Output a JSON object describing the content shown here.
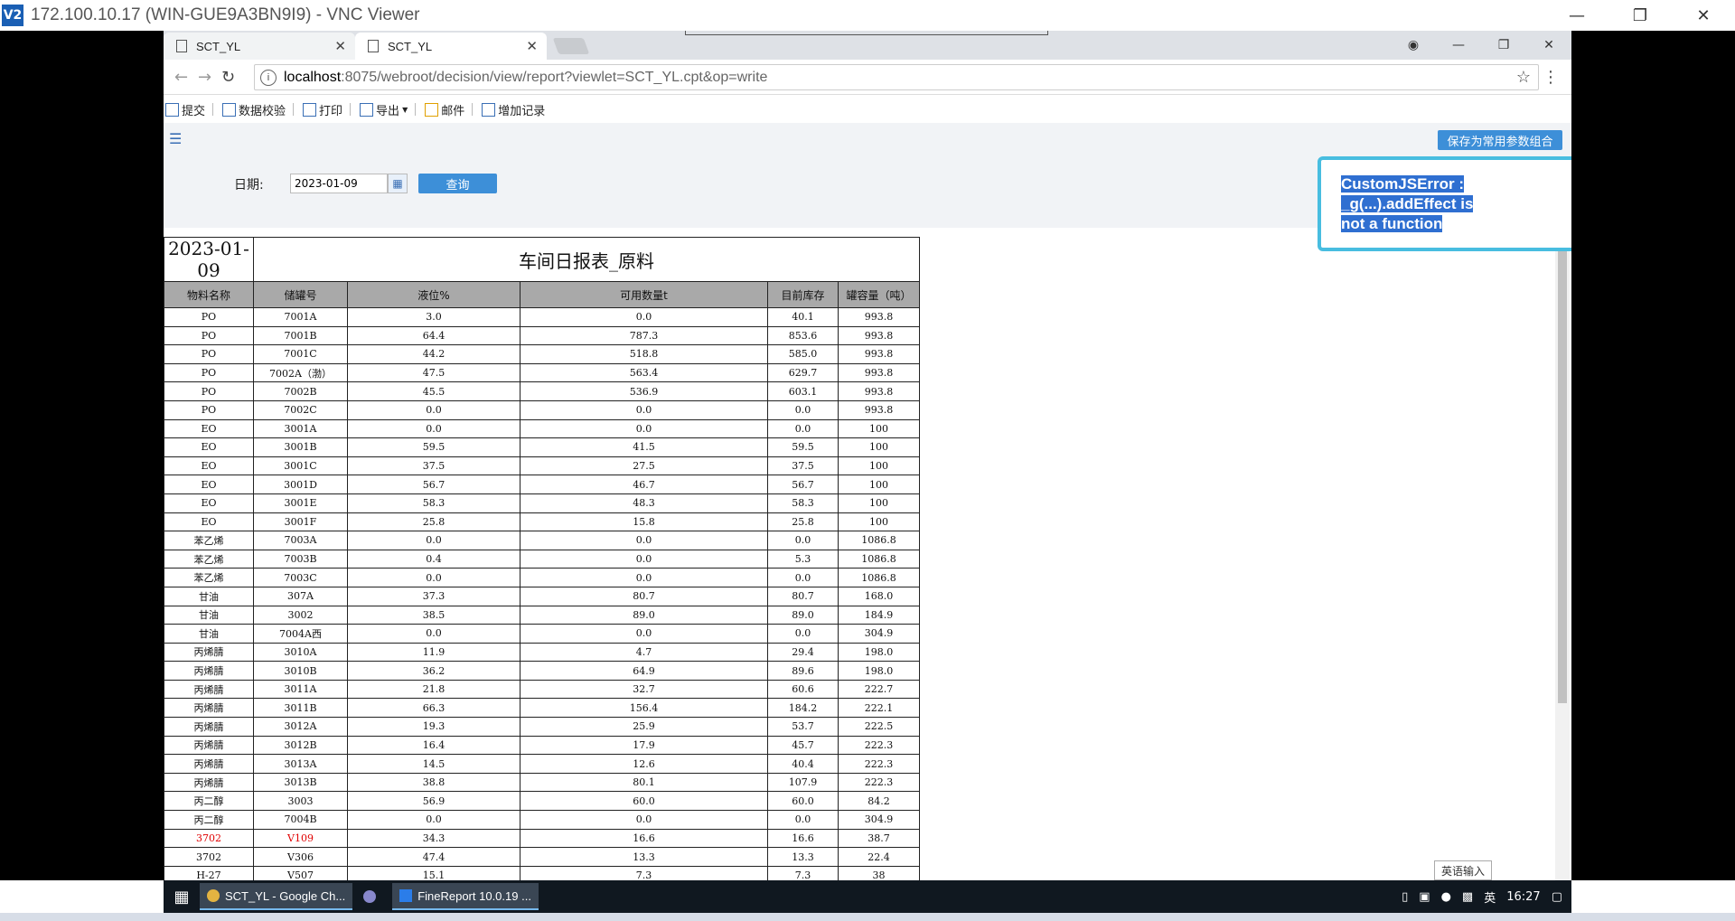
{
  "vnc": {
    "title": "172.100.10.17 (WIN-GUE9A3BN9I9) - VNC Viewer",
    "logo": "V2"
  },
  "browser": {
    "tabs": [
      {
        "label": "SCT_YL"
      },
      {
        "label": "SCT_YL"
      }
    ],
    "url_host": "localhost",
    "url_path": ":8075/webroot/decision/view/report?viewlet=SCT_YL.cpt&op=write"
  },
  "toolbar": {
    "items": [
      {
        "label": "提交",
        "icon": "submit-icon"
      },
      {
        "label": "数据校验",
        "icon": "validate-icon"
      },
      {
        "label": "打印",
        "icon": "print-icon"
      },
      {
        "label": "导出",
        "icon": "export-icon"
      },
      {
        "label": "邮件",
        "icon": "mail-icon"
      },
      {
        "label": "增加记录",
        "icon": "add-record-icon"
      }
    ],
    "save_params_label": "保存为常用参数组合"
  },
  "params": {
    "date_label": "日期:",
    "date_value": "2023-01-09",
    "query_label": "查询"
  },
  "report": {
    "date": "2023-01-09",
    "title": "车间日报表_原料",
    "headers": [
      "物料名称",
      "储罐号",
      "液位%",
      "可用数量t",
      "目前库存",
      "罐容量（吨）"
    ],
    "rows": [
      [
        "PO",
        "7001A",
        "3.0",
        "0.0",
        "40.1",
        "993.8"
      ],
      [
        "PO",
        "7001B",
        "64.4",
        "787.3",
        "853.6",
        "993.8"
      ],
      [
        "PO",
        "7001C",
        "44.2",
        "518.8",
        "585.0",
        "993.8"
      ],
      [
        "PO",
        "7002A（渤）",
        "47.5",
        "563.4",
        "629.7",
        "993.8"
      ],
      [
        "PO",
        "7002B",
        "45.5",
        "536.9",
        "603.1",
        "993.8"
      ],
      [
        "PO",
        "7002C",
        "0.0",
        "0.0",
        "0.0",
        "993.8"
      ],
      [
        "EO",
        "3001A",
        "0.0",
        "0.0",
        "0.0",
        "100"
      ],
      [
        "EO",
        "3001B",
        "59.5",
        "41.5",
        "59.5",
        "100"
      ],
      [
        "EO",
        "3001C",
        "37.5",
        "27.5",
        "37.5",
        "100"
      ],
      [
        "EO",
        "3001D",
        "56.7",
        "46.7",
        "56.7",
        "100"
      ],
      [
        "EO",
        "3001E",
        "58.3",
        "48.3",
        "58.3",
        "100"
      ],
      [
        "EO",
        "3001F",
        "25.8",
        "15.8",
        "25.8",
        "100"
      ],
      [
        "苯乙烯",
        "7003A",
        "0.0",
        "0.0",
        "0.0",
        "1086.8"
      ],
      [
        "苯乙烯",
        "7003B",
        "0.4",
        "0.0",
        "5.3",
        "1086.8"
      ],
      [
        "苯乙烯",
        "7003C",
        "0.0",
        "0.0",
        "0.0",
        "1086.8"
      ],
      [
        "甘油",
        "307A",
        "37.3",
        "80.7",
        "80.7",
        "168.0"
      ],
      [
        "甘油",
        "3002",
        "38.5",
        "89.0",
        "89.0",
        "184.9"
      ],
      [
        "甘油",
        "7004A西",
        "0.0",
        "0.0",
        "0.0",
        "304.9"
      ],
      [
        "丙烯腈",
        "3010A",
        "11.9",
        "4.7",
        "29.4",
        "198.0"
      ],
      [
        "丙烯腈",
        "3010B",
        "36.2",
        "64.9",
        "89.6",
        "198.0"
      ],
      [
        "丙烯腈",
        "3011A",
        "21.8",
        "32.7",
        "60.6",
        "222.7"
      ],
      [
        "丙烯腈",
        "3011B",
        "66.3",
        "156.4",
        "184.2",
        "222.1"
      ],
      [
        "丙烯腈",
        "3012A",
        "19.3",
        "25.9",
        "53.7",
        "222.5"
      ],
      [
        "丙烯腈",
        "3012B",
        "16.4",
        "17.9",
        "45.7",
        "222.3"
      ],
      [
        "丙烯腈",
        "3013A",
        "14.5",
        "12.6",
        "40.4",
        "222.3"
      ],
      [
        "丙烯腈",
        "3013B",
        "38.8",
        "80.1",
        "107.9",
        "222.3"
      ],
      [
        "丙二醇",
        "3003",
        "56.9",
        "60.0",
        "60.0",
        "84.2"
      ],
      [
        "丙二醇",
        "7004B",
        "0.0",
        "0.0",
        "0.0",
        "304.9"
      ],
      [
        "3702",
        "V109",
        "34.3",
        "16.6",
        "16.6",
        "38.7"
      ],
      [
        "3702",
        "V306",
        "47.4",
        "13.3",
        "13.3",
        "22.4"
      ],
      [
        "H-27",
        "V507",
        "15.1",
        "7.3",
        "7.3",
        "38"
      ]
    ],
    "red_row_index": 28
  },
  "error": {
    "text": "CustomJSError : _g(...).addEffect is not a function"
  },
  "ime_hint": "英语输入",
  "taskbar": {
    "tasks": [
      "SCT_YL - Google Ch...",
      "FineReport 10.0.19 ..."
    ],
    "ime": "英",
    "clock": "16:27"
  }
}
